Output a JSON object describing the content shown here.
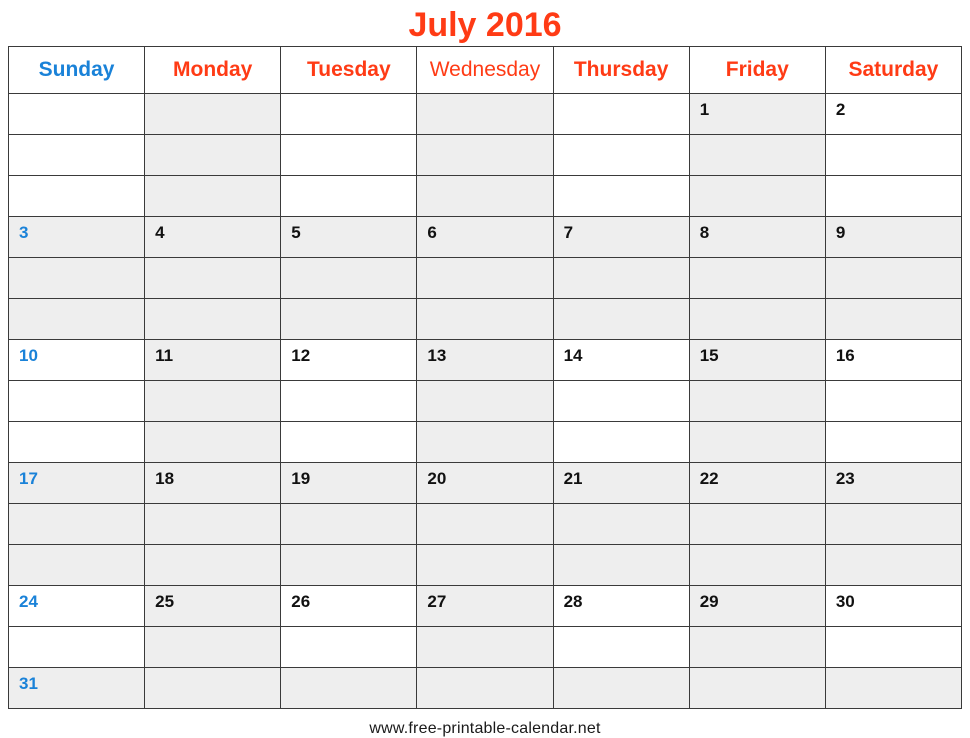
{
  "title": "July 2016",
  "weekdays": [
    {
      "label": "Sunday",
      "style": "sun"
    },
    {
      "label": "Monday",
      "style": "bold"
    },
    {
      "label": "Tuesday",
      "style": "bold"
    },
    {
      "label": "Wednesday",
      "style": "light"
    },
    {
      "label": "Thursday",
      "style": "bold"
    },
    {
      "label": "Friday",
      "style": "bold"
    },
    {
      "label": "Saturday",
      "style": "bold"
    }
  ],
  "weeks": [
    {
      "shading": "columns",
      "rows": 3,
      "days": [
        "",
        "",
        "",
        "",
        "",
        "1",
        "2"
      ]
    },
    {
      "shading": "full",
      "rows": 3,
      "days": [
        "3",
        "4",
        "5",
        "6",
        "7",
        "8",
        "9"
      ]
    },
    {
      "shading": "columns",
      "rows": 3,
      "days": [
        "10",
        "11",
        "12",
        "13",
        "14",
        "15",
        "16"
      ]
    },
    {
      "shading": "full",
      "rows": 3,
      "days": [
        "17",
        "18",
        "19",
        "20",
        "21",
        "22",
        "23"
      ]
    },
    {
      "shading": "columns",
      "rows": 2,
      "days": [
        "24",
        "25",
        "26",
        "27",
        "28",
        "29",
        "30"
      ]
    },
    {
      "shading": "full",
      "rows": 1,
      "days": [
        "31",
        "",
        "",
        "",
        "",
        "",
        ""
      ]
    }
  ],
  "shaded_columns": [
    1,
    3,
    5
  ],
  "footer": "www.free-printable-calendar.net",
  "colors": {
    "title": "#ff3b15",
    "weekday_red": "#ff3b15",
    "sunday_blue": "#1a82d8",
    "date_black": "#111111",
    "shade": "#eeeeee",
    "border": "#3a3a3a"
  }
}
